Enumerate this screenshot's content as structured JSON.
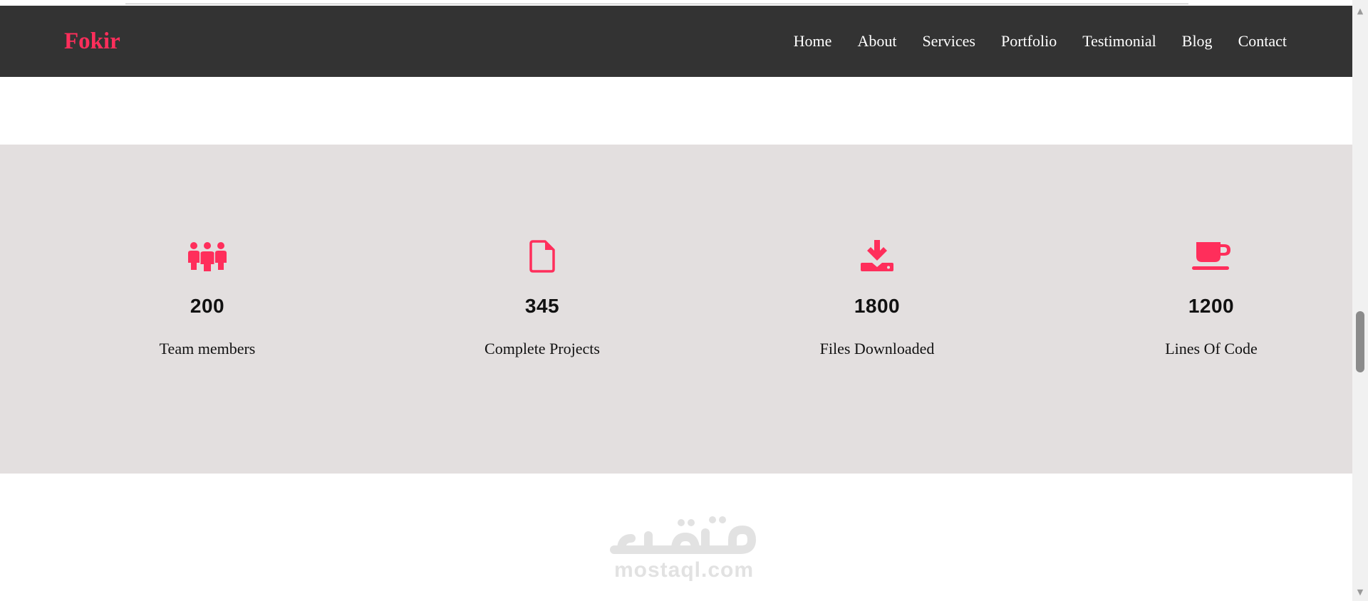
{
  "brand": {
    "name": "Fokir",
    "color": "#ff2e5b"
  },
  "nav": {
    "items": [
      "Home",
      "About",
      "Services",
      "Portfolio",
      "Testimonial",
      "Blog",
      "Contact"
    ]
  },
  "stats": [
    {
      "icon": "team-icon",
      "value": "200",
      "label": "Team members"
    },
    {
      "icon": "file-icon",
      "value": "345",
      "label": "Complete Projects"
    },
    {
      "icon": "download-icon",
      "value": "1800",
      "label": "Files Downloaded"
    },
    {
      "icon": "coffee-cup-icon",
      "value": "1200",
      "label": "Lines Of Code"
    }
  ],
  "colors": {
    "accent": "#ff2e5b",
    "navbar": "#333333",
    "stats_bg": "#e3dfdf"
  },
  "watermark": {
    "text": "mostaql.com"
  }
}
